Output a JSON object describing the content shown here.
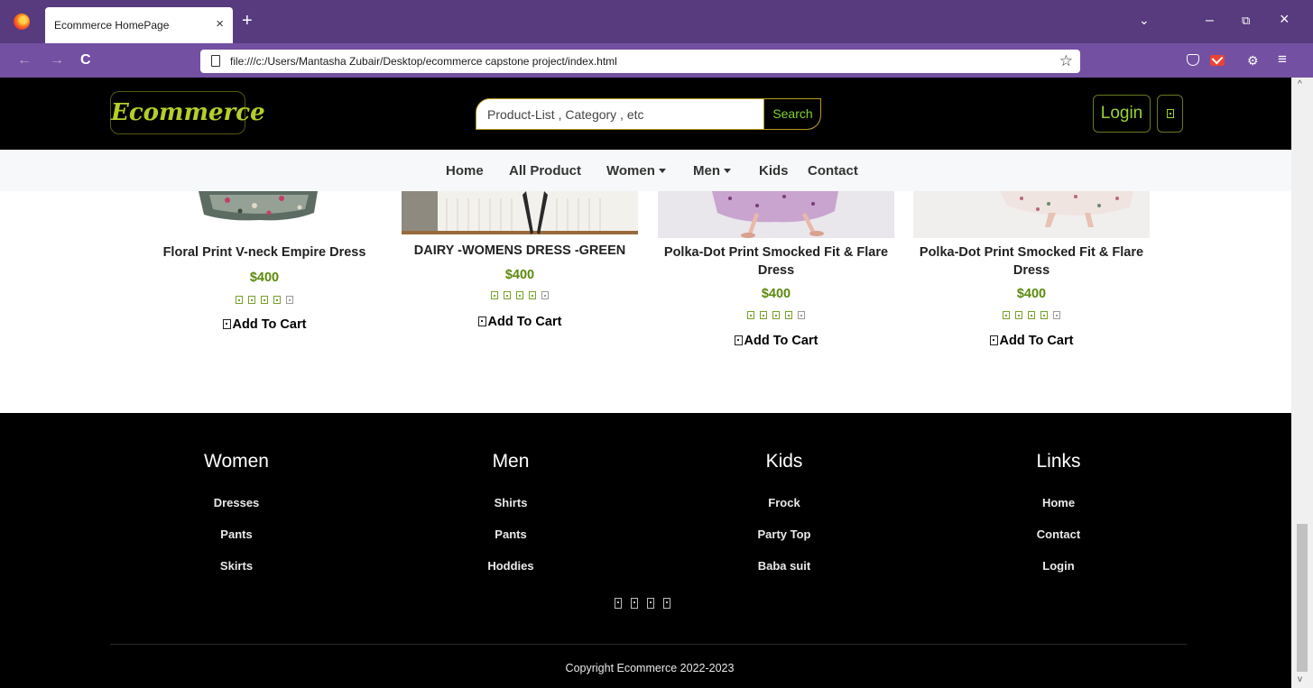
{
  "browser": {
    "tab_title": "Ecommerce HomePage",
    "tab_close": "×",
    "new_tab": "+",
    "url": "file:///c:/Users/Mantasha Zubair/Desktop/ecommerce capstone project/index.html",
    "back": "←",
    "forward": "→",
    "reload": "C",
    "star": "☆",
    "list_tabs": "⌄",
    "minimize": "–",
    "restore": "⧉",
    "close": "×",
    "menu": "≡",
    "extension": "⚙"
  },
  "header": {
    "logo": "Ecommerce",
    "search_placeholder": "Product-List , Category , etc",
    "search_button": "Search",
    "login": "Login"
  },
  "nav": {
    "home": "Home",
    "all_product": "All Product",
    "women": "Women",
    "men": "Men",
    "kids": "Kids",
    "contact": "Contact"
  },
  "products": [
    {
      "name": "Floral Print V-neck Empire Dress",
      "price": "$400",
      "rating": 5,
      "cart": "Add To Cart"
    },
    {
      "name": "DAIRY -WOMENS DRESS -GREEN",
      "price": "$400",
      "rating": 5,
      "cart": "Add To Cart"
    },
    {
      "name": "Polka-Dot Print Smocked Fit & Flare Dress",
      "price": "$400",
      "rating": 5,
      "cart": "Add To Cart"
    },
    {
      "name": "Polka-Dot Print Smocked Fit & Flare Dress",
      "price": "$400",
      "rating": 5,
      "cart": "Add To Cart"
    }
  ],
  "footer": {
    "columns": [
      {
        "heading": "Women",
        "links": [
          "Dresses",
          "Pants",
          "Skirts"
        ]
      },
      {
        "heading": "Men",
        "links": [
          "Shirts",
          "Pants",
          "Hoddies"
        ]
      },
      {
        "heading": "Kids",
        "links": [
          "Frock",
          "Party Top",
          "Baba suit"
        ]
      },
      {
        "heading": "Links",
        "links": [
          "Home",
          "Contact",
          "Login"
        ]
      }
    ],
    "copyright": "Copyright Ecommerce 2022-2023"
  },
  "colors": {
    "accent_green": "#9ad534",
    "price_green": "#5a8a0c",
    "browser_purple": "#573b7e"
  }
}
